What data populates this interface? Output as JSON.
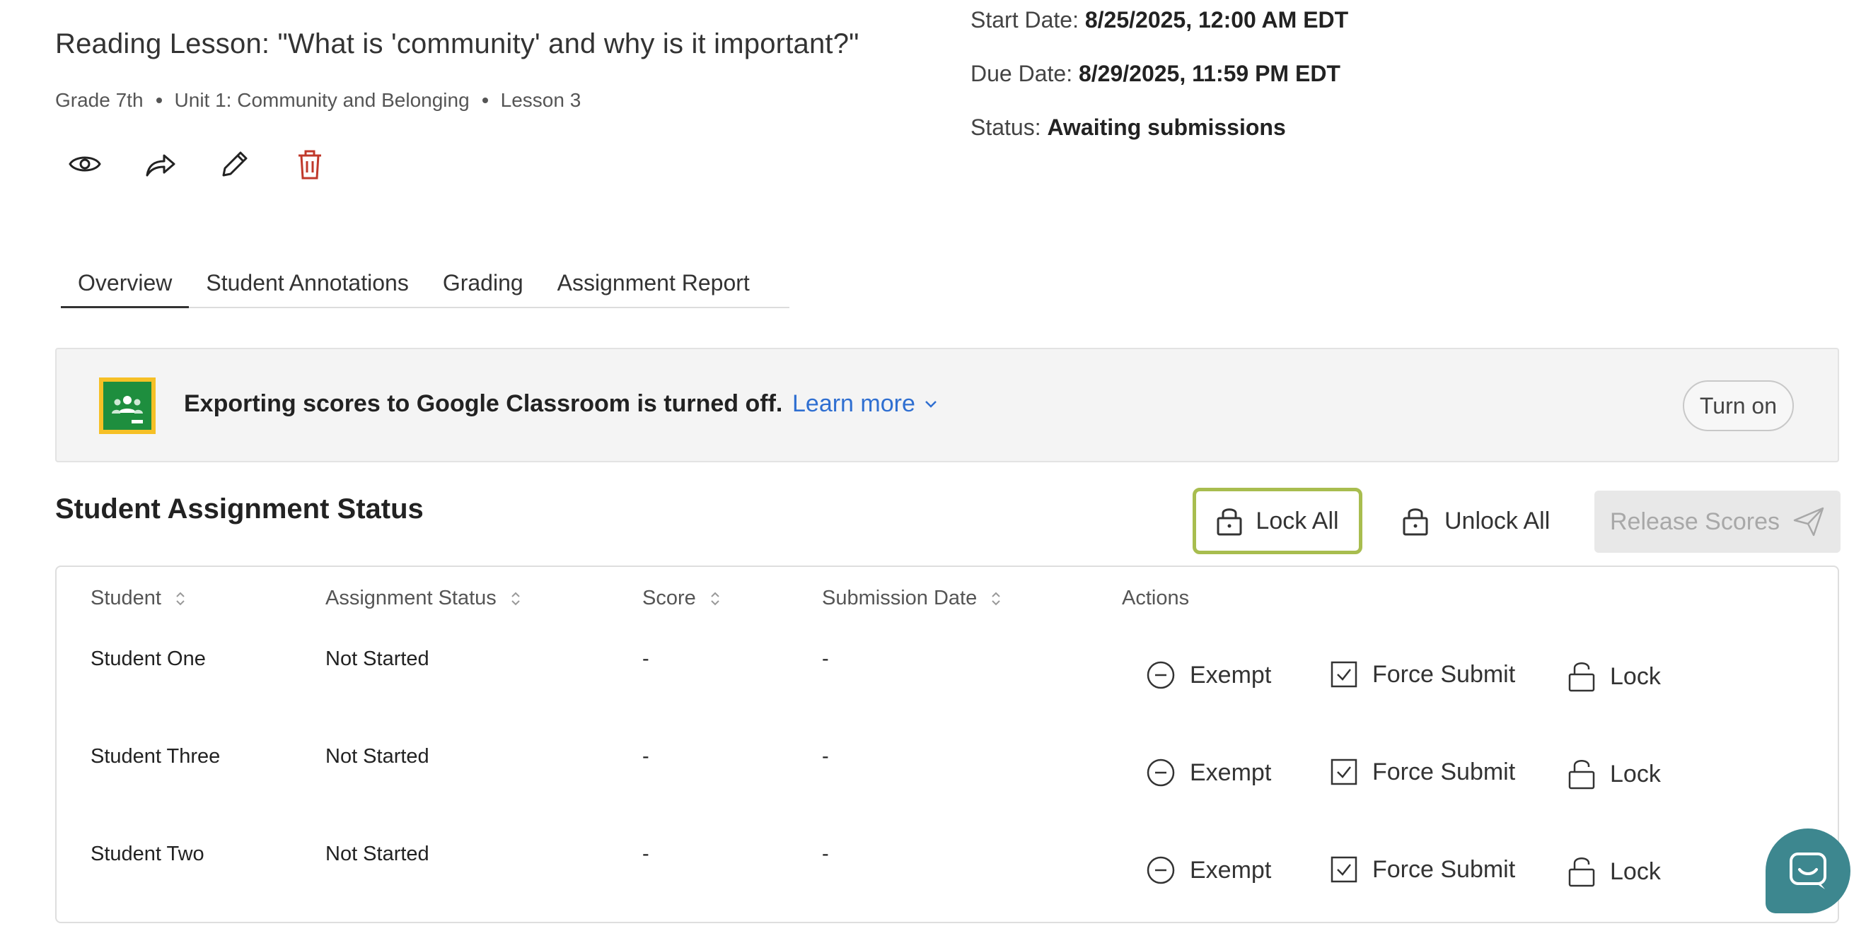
{
  "lesson": {
    "title": "Reading Lesson: \"What is 'community' and why is it important?\"",
    "grade": "Grade 7th",
    "unit": "Unit 1: Community and Belonging",
    "lesson": "Lesson 3"
  },
  "toolbar_icons": [
    "eye-icon",
    "share-icon",
    "pencil-icon",
    "trash-icon"
  ],
  "info": {
    "start_label": "Start Date:",
    "start_value": "8/25/2025, 12:00 AM EDT",
    "due_label": "Due Date:",
    "due_value": "8/29/2025, 11:59 PM EDT",
    "status_label": "Status:",
    "status_value": "Awaiting submissions"
  },
  "tabs": [
    {
      "label": "Overview",
      "active": true
    },
    {
      "label": "Student Annotations",
      "active": false
    },
    {
      "label": "Grading",
      "active": false
    },
    {
      "label": "Assignment Report",
      "active": false
    }
  ],
  "banner": {
    "text": "Exporting scores to Google Classroom is turned off.",
    "learn_more": "Learn more",
    "button": "Turn on"
  },
  "section": {
    "title": "Student Assignment Status",
    "lock_all": "Lock All",
    "unlock_all": "Unlock All",
    "release_scores": "Release Scores"
  },
  "table": {
    "headers": [
      "Student",
      "Assignment Status",
      "Score",
      "Submission Date",
      "Actions"
    ],
    "rows": [
      {
        "student": "Student One",
        "status": "Not Started",
        "score": "-",
        "submission_date": "-"
      },
      {
        "student": "Student Three",
        "status": "Not Started",
        "score": "-",
        "submission_date": "-"
      },
      {
        "student": "Student Two",
        "status": "Not Started",
        "score": "-",
        "submission_date": "-"
      }
    ],
    "actions": {
      "exempt": "Exempt",
      "force_submit": "Force Submit",
      "lock": "Lock"
    }
  },
  "colors": {
    "link": "#2f6fd1",
    "trash": "#c0392b",
    "lock_all_border": "#a8bd4f",
    "chat": "#3d878f",
    "google_yellow": "#f6c026",
    "google_green": "#1e8e3e"
  }
}
